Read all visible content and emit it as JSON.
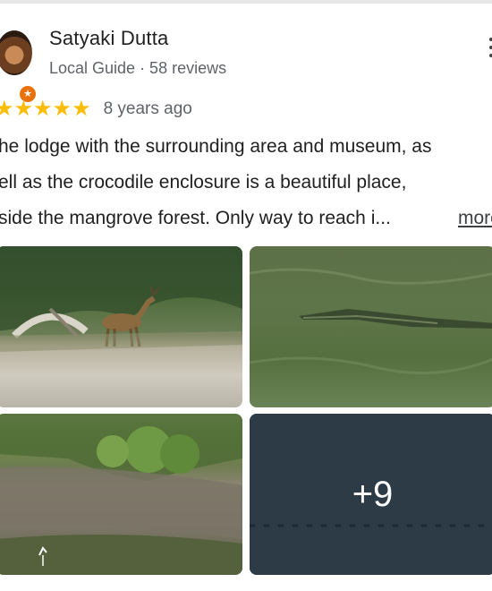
{
  "review": {
    "author": "Satyaki Dutta",
    "author_meta": "Local Guide · 58 reviews",
    "rating": 5,
    "stars_text": "★★★★★",
    "age": "8 years ago",
    "text_lines": [
      "he lodge with the surrounding area and museum, as",
      "ell as the crocodile enclosure is a beautiful place,",
      "side the mangrove forest. Only way to reach i..."
    ],
    "more_label": "more",
    "photos": [
      {
        "name": "deer-photo"
      },
      {
        "name": "crocodile-photo"
      },
      {
        "name": "mangrove-photo"
      },
      {
        "name": "more-photos",
        "overlay": "+9"
      }
    ]
  },
  "colors": {
    "star": "#fbbc04",
    "guide_badge": "#e8710a",
    "meta_text": "#5f6368"
  }
}
